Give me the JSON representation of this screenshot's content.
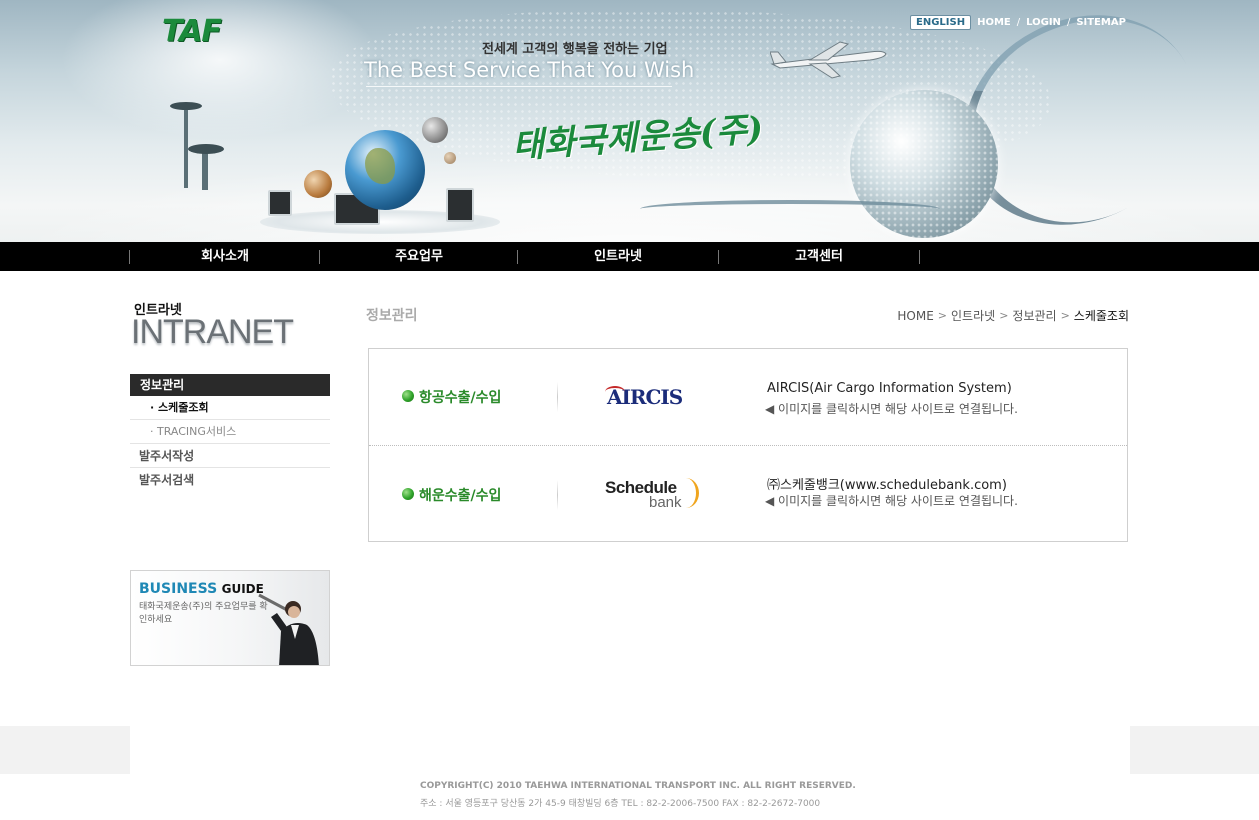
{
  "header": {
    "logo": "TAF",
    "slogan_ko": "전세계 고객의 행복을 전하는 기업",
    "slogan_en": "The Best Service That You Wish",
    "company_name": "태화국제운송(주)",
    "top_links": {
      "english": "ENGLISH",
      "home": "HOME",
      "login": "LOGIN",
      "sitemap": "SITEMAP",
      "separator": "/"
    }
  },
  "nav": {
    "items": [
      {
        "label": "회사소개"
      },
      {
        "label": "주요업무"
      },
      {
        "label": "인트라넷"
      },
      {
        "label": "고객센터"
      }
    ],
    "separator": "|"
  },
  "sidebar": {
    "title_ko": "인트라넷",
    "title_en": "INTRANET",
    "menu_head": "정보관리",
    "sub_items": [
      {
        "label": "· 스케줄조회",
        "active": true
      },
      {
        "label": "· TRACING서비스",
        "active": false
      }
    ],
    "main_items": [
      {
        "label": "발주서작성"
      },
      {
        "label": "발주서검색"
      }
    ],
    "business_guide": {
      "title_part1": "BUSINESS",
      "title_part2": "GUIDE",
      "description": "태화국제운송(주)의 주요업무를 확인하세요"
    }
  },
  "main": {
    "page_title": "정보관리",
    "breadcrumb": [
      "HOME",
      "인트라넷",
      "정보관리",
      "스케줄조회"
    ],
    "breadcrumb_sep": ">",
    "rows": [
      {
        "label": "항공수출/수입",
        "logo_text": "AIRCIS",
        "title": "AIRCIS(Air Cargo Information System)",
        "desc": "◀ 이미지를 클릭하시면 해당 사이트로 연결됩니다."
      },
      {
        "label": "해운수출/수입",
        "logo_text_1": "Schedule",
        "logo_text_2": "bank",
        "title": "㈜스케줄뱅크(www.schedulebank.com)",
        "desc": "◀ 이미지를 클릭하시면 해당 사이트로 연결됩니다."
      }
    ]
  },
  "footer": {
    "copyright": "COPYRIGHT(C) 2010 TAEHWA INTERNATIONAL TRANSPORT INC. ALL RIGHT RESERVED.",
    "address": "주소 : 서울 영등포구 당산동 2가 45-9 태창빌딩 6층  TEL : 82-2-2006-7500  FAX : 82-2-2672-7000"
  },
  "colors": {
    "brand_green": "#1b8a3c",
    "nav_bg": "#000000",
    "accent_blue": "#1f88b5"
  }
}
